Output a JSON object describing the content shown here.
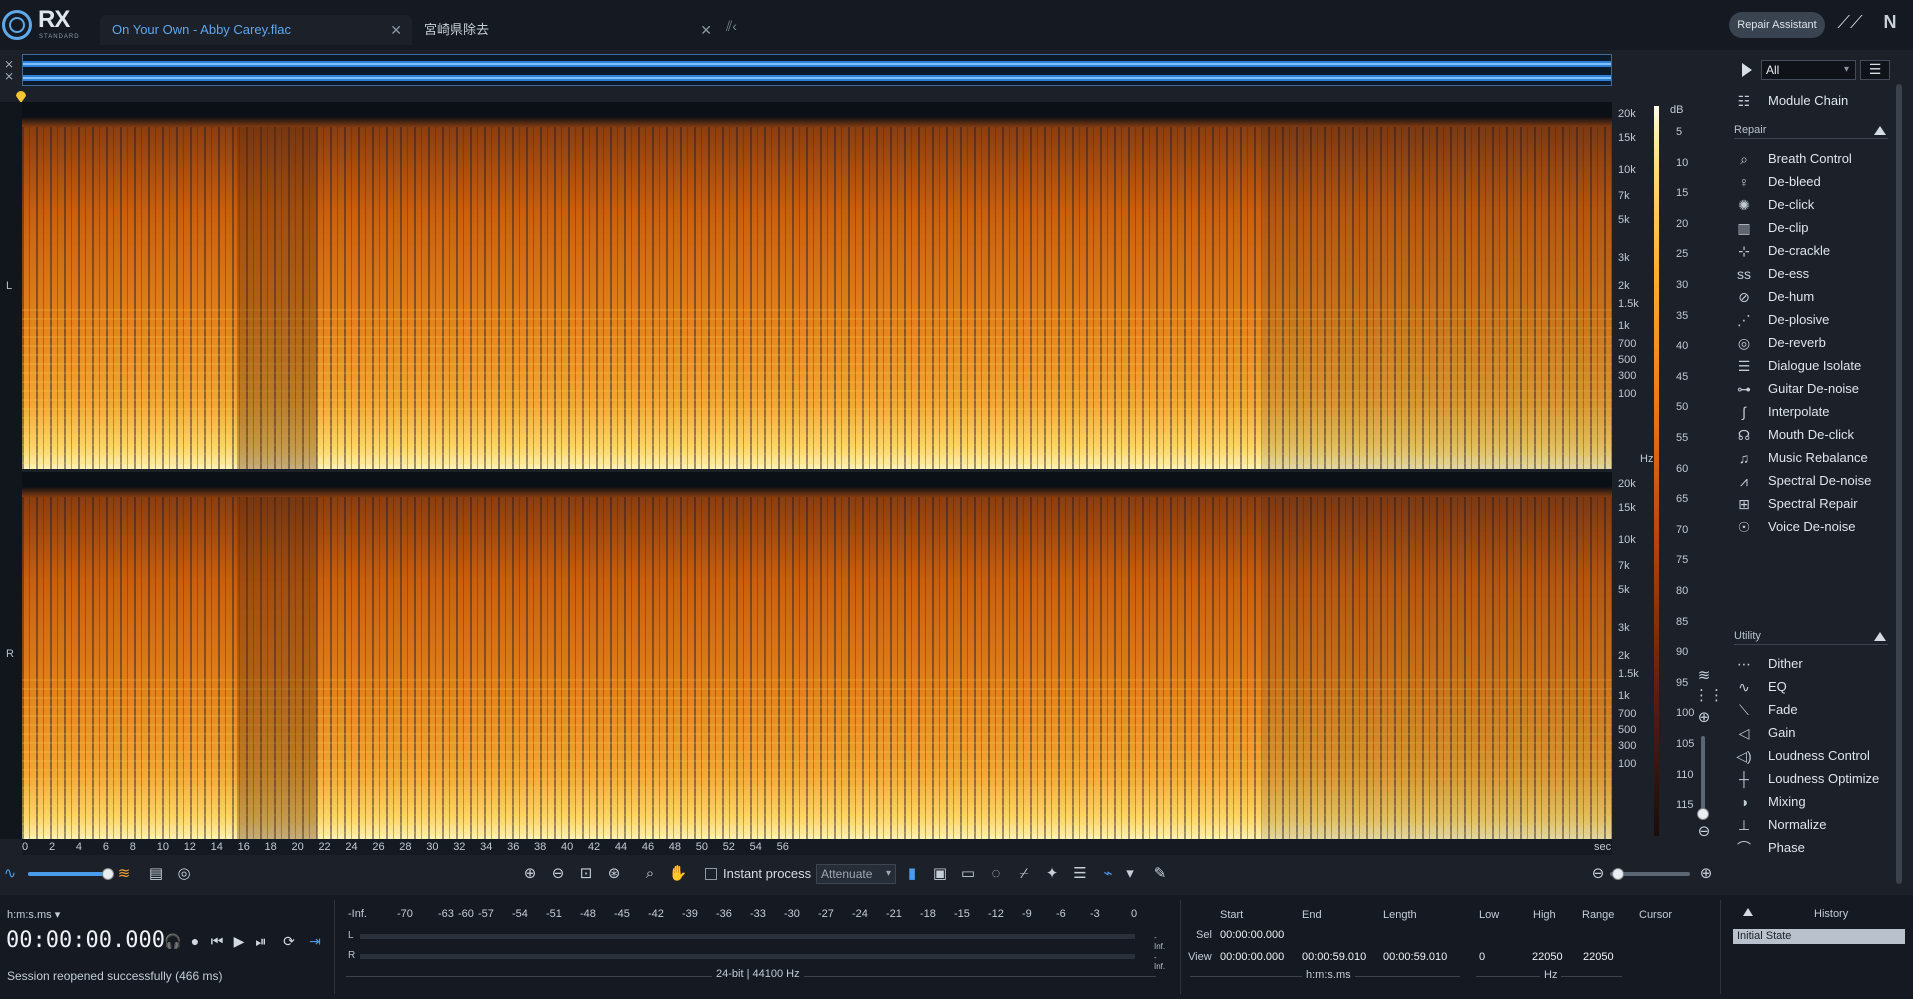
{
  "app": {
    "logo_text": "RX",
    "logo_subtitle": "STANDARD",
    "tabs": [
      {
        "label": "On Your Own - Abby Carey.flac",
        "active": true
      },
      {
        "label": "宮崎県除去",
        "active": false
      }
    ],
    "repair_assistant_label": "Repair Assistant",
    "accent_color": "#4a9bea"
  },
  "spectrogram": {
    "channels": [
      {
        "label": "L"
      },
      {
        "label": "R"
      }
    ],
    "hz_ticks": [
      "20k",
      "15k",
      "10k",
      "7k",
      "5k",
      "3k",
      "2k",
      "1.5k",
      "1k",
      "700",
      "500",
      "300",
      "100"
    ],
    "hz_unit": "Hz",
    "db_unit": "dB",
    "db_ticks": [
      "5",
      "10",
      "15",
      "20",
      "25",
      "30",
      "35",
      "40",
      "45",
      "50",
      "55",
      "60",
      "65",
      "70",
      "75",
      "80",
      "85",
      "90",
      "95",
      "100",
      "105",
      "110",
      "115"
    ],
    "time_ticks": [
      "0",
      "2",
      "4",
      "6",
      "8",
      "10",
      "12",
      "14",
      "16",
      "18",
      "20",
      "22",
      "24",
      "26",
      "28",
      "30",
      "32",
      "34",
      "36",
      "38",
      "40",
      "42",
      "44",
      "46",
      "48",
      "50",
      "52",
      "54",
      "56"
    ],
    "time_unit": "sec"
  },
  "modules": {
    "filter_value": "All",
    "module_chain_label": "Module Chain",
    "repair_section_label": "Repair",
    "repair": [
      {
        "label": "Breath Control",
        "icon": "breath-icon"
      },
      {
        "label": "De-bleed",
        "icon": "mic-icon"
      },
      {
        "label": "De-click",
        "icon": "sparkle-icon"
      },
      {
        "label": "De-clip",
        "icon": "clip-icon"
      },
      {
        "label": "De-crackle",
        "icon": "crackle-icon"
      },
      {
        "label": "De-ess",
        "icon": "ess-icon"
      },
      {
        "label": "De-hum",
        "icon": "hum-icon"
      },
      {
        "label": "De-plosive",
        "icon": "plosive-icon"
      },
      {
        "label": "De-reverb",
        "icon": "reverb-icon"
      },
      {
        "label": "Dialogue Isolate",
        "icon": "dialogue-icon"
      },
      {
        "label": "Guitar De-noise",
        "icon": "guitar-icon"
      },
      {
        "label": "Interpolate",
        "icon": "interpolate-icon"
      },
      {
        "label": "Mouth De-click",
        "icon": "mouth-icon"
      },
      {
        "label": "Music Rebalance",
        "icon": "music-icon"
      },
      {
        "label": "Spectral De-noise",
        "icon": "spectral-denoise-icon"
      },
      {
        "label": "Spectral Repair",
        "icon": "spectral-repair-icon"
      },
      {
        "label": "Voice De-noise",
        "icon": "voice-icon"
      }
    ],
    "utility_section_label": "Utility",
    "utility": [
      {
        "label": "Dither",
        "icon": "dither-icon"
      },
      {
        "label": "EQ",
        "icon": "eq-icon"
      },
      {
        "label": "Fade",
        "icon": "fade-icon"
      },
      {
        "label": "Gain",
        "icon": "gain-icon"
      },
      {
        "label": "Loudness Control",
        "icon": "loudness-control-icon"
      },
      {
        "label": "Loudness Optimize",
        "icon": "loudness-optimize-icon"
      },
      {
        "label": "Mixing",
        "icon": "mixing-icon"
      },
      {
        "label": "Normalize",
        "icon": "normalize-icon"
      },
      {
        "label": "Phase",
        "icon": "phase-icon"
      }
    ]
  },
  "toolbar": {
    "instant_process_label": "Instant process",
    "instant_process_checked": false,
    "attenuate_value": "Attenuate"
  },
  "transport": {
    "time_format": "h:m:s.ms",
    "timecode": "00:00:00.000",
    "status_message": "Session reopened successfully (466 ms)"
  },
  "meter": {
    "scale": [
      "-Inf.",
      "-70",
      "-63",
      "-60",
      "-57",
      "-54",
      "-51",
      "-48",
      "-45",
      "-42",
      "-39",
      "-36",
      "-33",
      "-30",
      "-27",
      "-24",
      "-21",
      "-18",
      "-15",
      "-12",
      "-9",
      "-6",
      "-3",
      "0"
    ],
    "left_label": "L",
    "right_label": "R",
    "left_value": "-Inf.",
    "right_value": "-Inf.",
    "format": "24-bit | 44100 Hz"
  },
  "selection": {
    "headers": {
      "start": "Start",
      "end": "End",
      "length": "Length",
      "low": "Low",
      "high": "High",
      "range": "Range",
      "cursor": "Cursor"
    },
    "sel_label": "Sel",
    "view_label": "View",
    "sel_start": "00:00:00.000",
    "view_start": "00:00:00.000",
    "view_end": "00:00:59.010",
    "view_length": "00:00:59.010",
    "low": "0",
    "high": "22050",
    "range": "22050",
    "time_unit": "h:m:s.ms",
    "freq_unit": "Hz"
  },
  "history": {
    "title": "History",
    "items": [
      "Initial State"
    ]
  }
}
